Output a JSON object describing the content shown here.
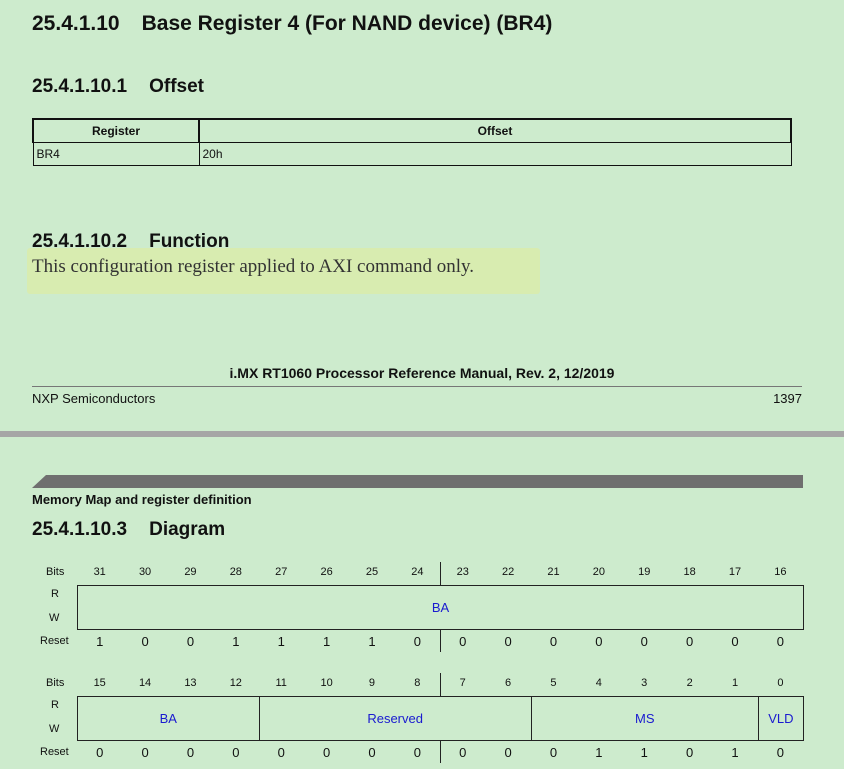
{
  "section_title": {
    "number": "25.4.1.10",
    "text": "Base Register 4 (For NAND device) (BR4)"
  },
  "offset_section": {
    "number": "25.4.1.10.1",
    "text": "Offset",
    "headers": [
      "Register",
      "Offset"
    ],
    "rows": [
      [
        "BR4",
        "20h"
      ]
    ]
  },
  "function_section": {
    "number": "25.4.1.10.2",
    "text": "Function",
    "body": "This configuration register applied to AXI command only."
  },
  "footer": {
    "manual_title": "i.MX RT1060 Processor Reference Manual, Rev. 2, 12/2019",
    "company": "NXP Semiconductors",
    "page": "1397"
  },
  "page2_header": "Memory Map and register definition",
  "diagram_section": {
    "number": "25.4.1.10.3",
    "text": "Diagram"
  },
  "diagram": {
    "labels": {
      "bits": "Bits",
      "r": "R",
      "w": "W",
      "reset": "Reset"
    },
    "upper": {
      "bits": [
        "31",
        "30",
        "29",
        "28",
        "27",
        "26",
        "25",
        "24",
        "23",
        "22",
        "21",
        "20",
        "19",
        "18",
        "17",
        "16"
      ],
      "reset": [
        "1",
        "0",
        "0",
        "1",
        "1",
        "1",
        "1",
        "0",
        "0",
        "0",
        "0",
        "0",
        "0",
        "0",
        "0",
        "0"
      ],
      "fields": [
        {
          "name": "BA",
          "span": 16
        }
      ]
    },
    "lower": {
      "bits": [
        "15",
        "14",
        "13",
        "12",
        "11",
        "10",
        "9",
        "8",
        "7",
        "6",
        "5",
        "4",
        "3",
        "2",
        "1",
        "0"
      ],
      "reset": [
        "0",
        "0",
        "0",
        "0",
        "0",
        "0",
        "0",
        "0",
        "0",
        "0",
        "0",
        "1",
        "1",
        "0",
        "1",
        "0"
      ],
      "fields": [
        {
          "name": "BA",
          "span": 4
        },
        {
          "name": "Reserved",
          "span": 6
        },
        {
          "name": "MS",
          "span": 5
        },
        {
          "name": "VLD",
          "span": 1
        }
      ]
    },
    "field_color": "#1a1ad0"
  }
}
